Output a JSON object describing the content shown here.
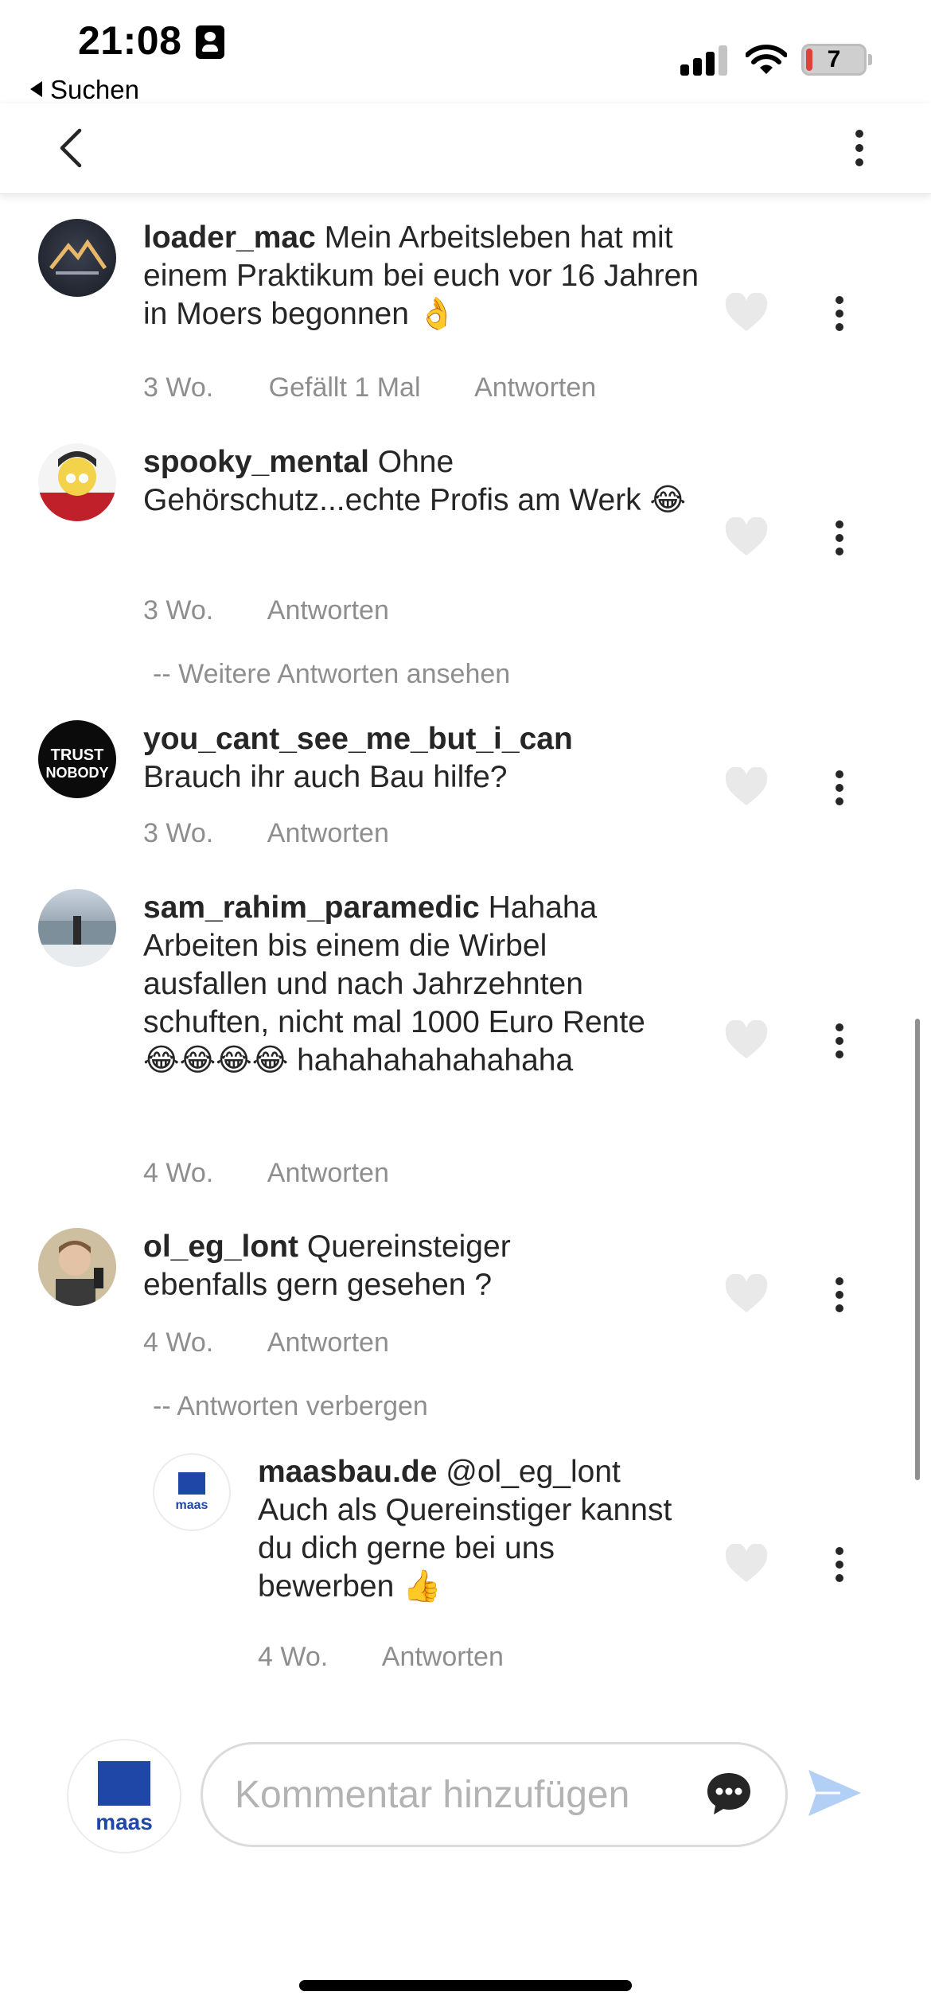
{
  "status_bar": {
    "time": "21:08",
    "back_app": "Suchen",
    "battery": "7"
  },
  "comments": [
    {
      "username": "loader_mac",
      "text": "Mein Arbeitsleben hat mit einem Praktikum bei euch  vor 16 Jahren in Moers begonnen 👌",
      "time": "3 Wo.",
      "likes": "Gefällt 1 Mal",
      "reply": "Antworten"
    },
    {
      "username": "spooky_mental",
      "text": "Ohne Gehörschutz...echte Profis am Werk 😂",
      "time": "3 Wo.",
      "reply": "Antworten",
      "more_replies": "-- Weitere Antworten ansehen"
    },
    {
      "username": "you_cant_see_me_but_i_can",
      "text": "Brauch ihr auch Bau hilfe?",
      "time": "3 Wo.",
      "reply": "Antworten"
    },
    {
      "username": "sam_rahim_paramedic",
      "text": "Hahaha Arbeiten bis einem die Wirbel ausfallen und nach Jahrzehnten schuften, nicht mal 1000 Euro Rente 😂😂😂😂 hahahahahahahaha",
      "time": "4 Wo.",
      "reply": "Antworten"
    },
    {
      "username": "ol_eg_lont",
      "text": "Quereinsteiger ebenfalls gern gesehen ?",
      "time": "4 Wo.",
      "reply": "Antworten",
      "hide_replies": "-- Antworten verbergen"
    },
    {
      "username": "maasbau.de",
      "text": "@ol_eg_lont Auch als Quereinstiger kannst du dich gerne bei uns bewerben 👍",
      "time": "4 Wo.",
      "reply": "Antworten",
      "avatar_label": "maas"
    }
  ],
  "composer": {
    "placeholder": "Kommentar hinzufügen",
    "avatar_label": "maas"
  },
  "colors": {
    "maas_blue": "#1f47a8",
    "send_blue": "#b2cff5",
    "meta_grey": "#8e8e8e"
  }
}
